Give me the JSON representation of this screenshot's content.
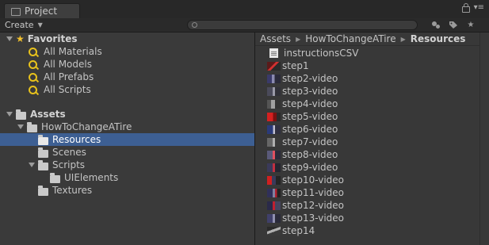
{
  "tab": {
    "title": "Project",
    "icon": "folder-icon"
  },
  "toolbar": {
    "create_label": "Create",
    "search_value": ""
  },
  "left": {
    "favorites_label": "Favorites",
    "favorites": [
      "All Materials",
      "All Models",
      "All Prefabs",
      "All Scripts"
    ],
    "assets_label": "Assets",
    "tree": {
      "root_child": "HowToChangeATire",
      "selected": "Resources",
      "scenes": "Scenes",
      "scripts": "Scripts",
      "uielements": "UIElements",
      "textures": "Textures"
    }
  },
  "breadcrumb": {
    "items": [
      "Assets",
      "HowToChangeATire"
    ],
    "current": "Resources"
  },
  "assets": [
    {
      "name": "instructionsCSV",
      "type": "text-asset"
    },
    {
      "name": "step1",
      "type": "texture"
    },
    {
      "name": "step2-video",
      "type": "video"
    },
    {
      "name": "step3-video",
      "type": "video"
    },
    {
      "name": "step4-video",
      "type": "video"
    },
    {
      "name": "step5-video",
      "type": "video"
    },
    {
      "name": "step6-video",
      "type": "video"
    },
    {
      "name": "step7-video",
      "type": "video"
    },
    {
      "name": "step8-video",
      "type": "video"
    },
    {
      "name": "step9-video",
      "type": "video"
    },
    {
      "name": "step10-video",
      "type": "video"
    },
    {
      "name": "step11-video",
      "type": "video"
    },
    {
      "name": "step12-video",
      "type": "video"
    },
    {
      "name": "step13-video",
      "type": "video"
    },
    {
      "name": "step14",
      "type": "texture"
    }
  ],
  "colors": {
    "selection": "#3d5f93",
    "favorite_star": "#f2c12e",
    "search_icon": "#e8c21c"
  }
}
